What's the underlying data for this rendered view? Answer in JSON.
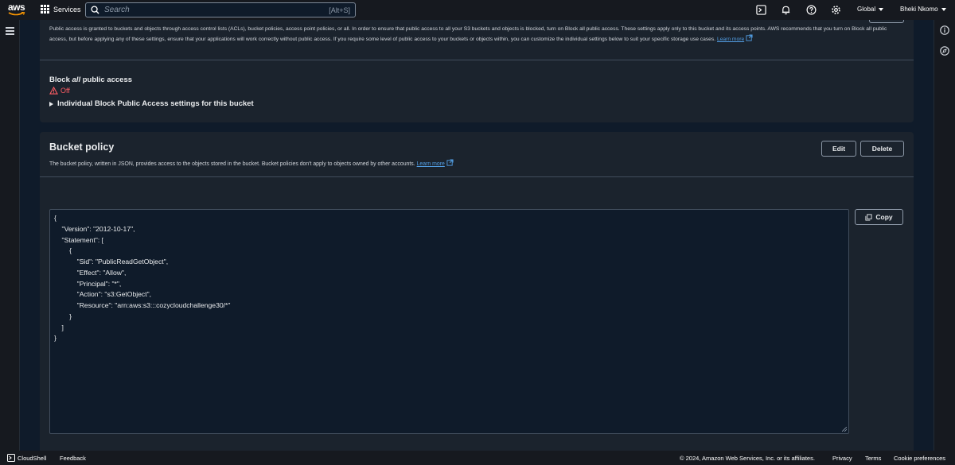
{
  "header": {
    "logo_text": "aws",
    "services_label": "Services",
    "search_placeholder": "Search",
    "search_shortcut": "[Alt+S]",
    "region": "Global",
    "user": "Bheki Nkomo"
  },
  "block_public_access": {
    "intro": "Public access is granted to buckets and objects through access control lists (ACLs), bucket policies, access point policies, or all. In order to ensure that public access to all your S3 buckets and objects is blocked, turn on Block all public access. These settings apply only to this bucket and its access points. AWS recommends that you turn on Block all public access, but before applying any of these settings, ensure that your applications will work correctly without public access. If you require some level of public access to your buckets or objects within, you can customize the individual settings below to suit your specific storage use cases.",
    "learn_more": "Learn more",
    "title_prefix": "Block",
    "title_em": "all",
    "title_suffix": "public access",
    "status": "Off",
    "expander_label": "Individual Block Public Access settings for this bucket"
  },
  "bucket_policy": {
    "title": "Bucket policy",
    "description": "The bucket policy, written in JSON, provides access to the objects stored in the bucket. Bucket policies don't apply to objects owned by other accounts.",
    "learn_more": "Learn more",
    "edit_label": "Edit",
    "delete_label": "Delete",
    "copy_label": "Copy",
    "code": "{\n    \"Version\": \"2012-10-17\",\n    \"Statement\": [\n        {\n            \"Sid\": \"PublicReadGetObject\",\n            \"Effect\": \"Allow\",\n            \"Principal\": \"*\",\n            \"Action\": \"s3:GetObject\",\n            \"Resource\": \"arn:aws:s3:::cozycloudchallenge30/*\"\n        }\n    ]\n}"
  },
  "footer": {
    "cloudshell": "CloudShell",
    "feedback": "Feedback",
    "copyright": "© 2024, Amazon Web Services, Inc. or its affiliates.",
    "privacy": "Privacy",
    "terms": "Terms",
    "cookies": "Cookie preferences"
  },
  "colors": {
    "accent_link": "#539fe5",
    "status_off": "#ff5d64",
    "background": "#0f1b2a",
    "panel": "#1b232d",
    "topbar": "#16191f"
  }
}
